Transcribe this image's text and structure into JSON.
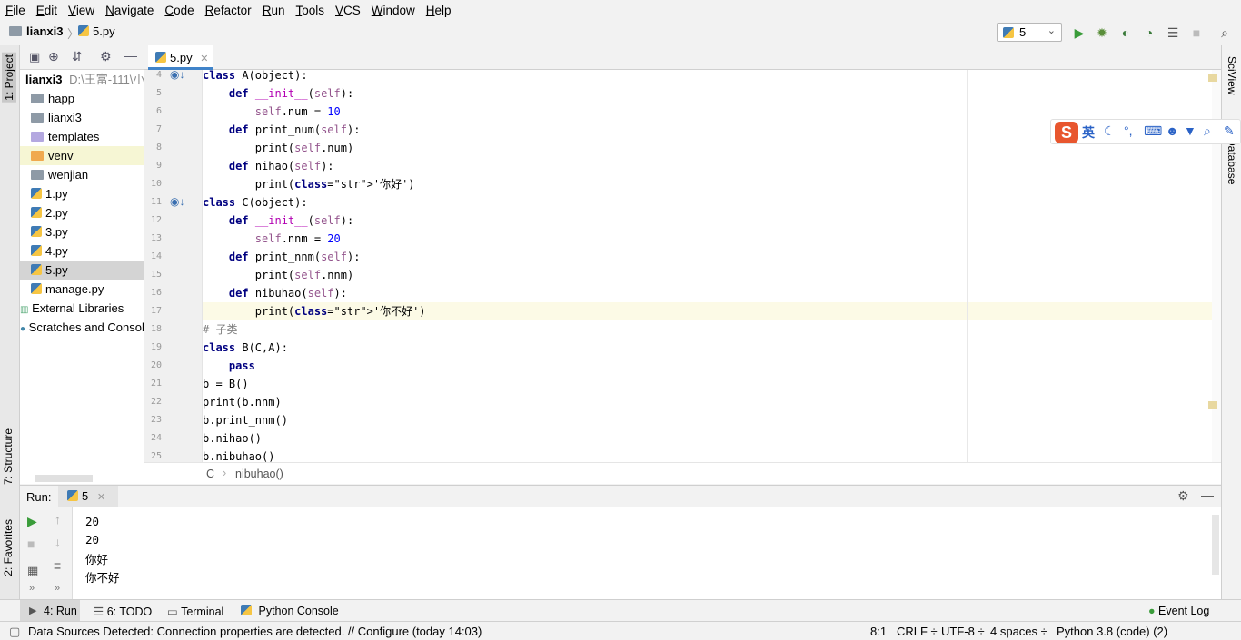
{
  "menu": [
    "File",
    "Edit",
    "View",
    "Navigate",
    "Code",
    "Refactor",
    "Run",
    "Tools",
    "VCS",
    "Window",
    "Help"
  ],
  "nav": {
    "project": "lianxi3",
    "file": "5.py"
  },
  "run_config": {
    "name": "5"
  },
  "left_tabs": {
    "project": "1: Project",
    "structure": "7: Structure",
    "favorites": "2: Favorites"
  },
  "right_tabs": {
    "sciview": "SciView",
    "database": "Database"
  },
  "project_tree": {
    "root_name": "lianxi3",
    "root_path": "D:\\王富-111\\小",
    "items": [
      {
        "label": "happ",
        "icon": "folder"
      },
      {
        "label": "lianxi3",
        "icon": "folder"
      },
      {
        "label": "templates",
        "icon": "folder-purple"
      },
      {
        "label": "venv",
        "icon": "folder-orange"
      },
      {
        "label": "wenjian",
        "icon": "folder"
      },
      {
        "label": "1.py",
        "icon": "python-file"
      },
      {
        "label": "2.py",
        "icon": "python-file"
      },
      {
        "label": "3.py",
        "icon": "python-file"
      },
      {
        "label": "4.py",
        "icon": "python-file"
      },
      {
        "label": "5.py",
        "icon": "python-file"
      },
      {
        "label": "manage.py",
        "icon": "python-file"
      }
    ],
    "external": "External Libraries",
    "scratches": "Scratches and Consoles"
  },
  "editor": {
    "tab": "5.py",
    "lines": [
      {
        "n": "4",
        "text": "class A(object):"
      },
      {
        "n": "5",
        "text": "    def __init__(self):"
      },
      {
        "n": "6",
        "text": "        self.num = 10"
      },
      {
        "n": "7",
        "text": "    def print_num(self):"
      },
      {
        "n": "8",
        "text": "        print(self.num)"
      },
      {
        "n": "9",
        "text": "    def nihao(self):"
      },
      {
        "n": "10",
        "text": "        print('你好')"
      },
      {
        "n": "11",
        "text": "class C(object):"
      },
      {
        "n": "12",
        "text": "    def __init__(self):"
      },
      {
        "n": "13",
        "text": "        self.nnm = 20"
      },
      {
        "n": "14",
        "text": "    def print_nnm(self):"
      },
      {
        "n": "15",
        "text": "        print(self.nnm)"
      },
      {
        "n": "16",
        "text": "    def nibuhao(self):"
      },
      {
        "n": "17",
        "text": "        print('你不好')"
      },
      {
        "n": "18",
        "text": "# 子类"
      },
      {
        "n": "19",
        "text": "class B(C,A):"
      },
      {
        "n": "20",
        "text": "    pass"
      },
      {
        "n": "21",
        "text": "b = B()"
      },
      {
        "n": "22",
        "text": "print(b.nnm)"
      },
      {
        "n": "23",
        "text": "b.print_nnm()"
      },
      {
        "n": "24",
        "text": "b.nihao()"
      },
      {
        "n": "25",
        "text": "b.nibuhao()"
      }
    ],
    "breadcrumb": [
      "C",
      "nibuhao()"
    ]
  },
  "run_panel": {
    "label": "Run:",
    "tab": "5",
    "output": [
      "20",
      "20",
      "你好",
      "你不好"
    ]
  },
  "tool_tabs": {
    "run": "4: Run",
    "todo": "6: TODO",
    "terminal": "Terminal",
    "python_console": "Python Console",
    "event_log": "Event Log"
  },
  "status": {
    "message": "Data Sources Detected: Connection properties are detected. // Configure (today 14:03)",
    "position": "8:1",
    "line_sep": "CRLF ÷",
    "encoding": "UTF-8 ÷",
    "indent": "4 spaces ÷",
    "interpreter": "Python 3.8 (code) (2)"
  },
  "ime": {
    "lang": "英"
  },
  "colors": {
    "accent": "#4083c9",
    "keyword": "#000080",
    "string": "#067d17",
    "number": "#0000ff",
    "self": "#94558d"
  }
}
